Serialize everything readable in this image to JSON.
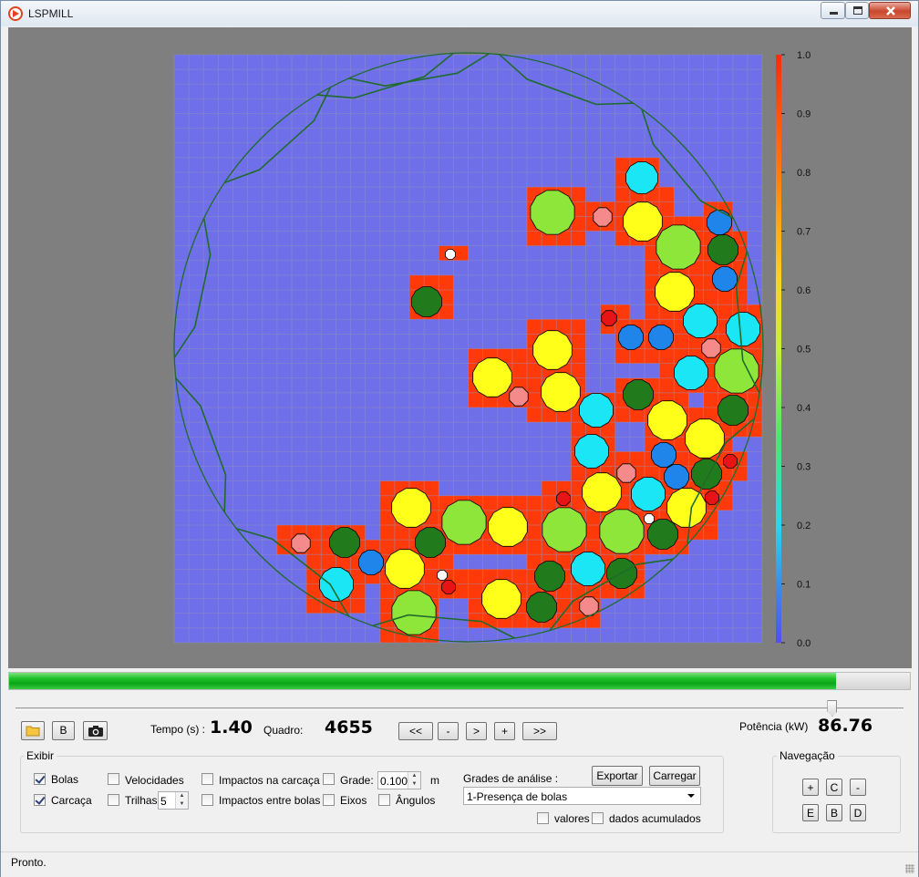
{
  "window": {
    "title": "LSPMILL"
  },
  "viewport": {
    "colorbar_ticks": [
      "1.0",
      "0.9",
      "0.8",
      "0.7",
      "0.6",
      "0.5",
      "0.4",
      "0.3",
      "0.2",
      "0.1",
      "0.0"
    ],
    "colors": {
      "background": "#7f7f7f",
      "empty_cell": "#6f6fe9",
      "occupied_cell": "#ff3a0a",
      "shell_line": "#1f6b2c"
    },
    "ball_colors": {
      "lime": "#8fe63a",
      "yellow": "#ffff1a",
      "cyan": "#1ae6f5",
      "blue": "#1f85ea",
      "darkgreen": "#217a1c",
      "pink": "#f58a8a",
      "red": "#e61414",
      "white": "#ffffff"
    }
  },
  "simulation": {
    "progress_fraction": 0.918,
    "slider_fraction": 0.925
  },
  "toolbar": {
    "b_label": "B",
    "time_label": "Tempo (s) :",
    "time_value": "1.40",
    "frame_label": "Quadro:",
    "frame_value": "4655",
    "nav_first": "<<",
    "nav_prev": "-",
    "nav_next": ">",
    "nav_plus": "+",
    "nav_last": ">>",
    "power_label": "Potência (kW)",
    "power_value": "86.76"
  },
  "exibir": {
    "title": "Exibir",
    "bolas": {
      "label": "Bolas",
      "checked": true
    },
    "carcaca": {
      "label": "Carcaça",
      "checked": true
    },
    "velocidades": {
      "label": "Velocidades",
      "checked": false
    },
    "trilhas": {
      "label": "Trilhas",
      "checked": false,
      "value": "5"
    },
    "impactos_carcaca": {
      "label": "Impactos na carcaça",
      "checked": false
    },
    "impactos_bolas": {
      "label": "Impactos entre bolas",
      "checked": false
    },
    "grade": {
      "label": "Grade:",
      "checked": false,
      "value": "0.100",
      "unit": "m"
    },
    "eixos": {
      "label": "Eixos",
      "checked": false
    },
    "angulos": {
      "label": "Ângulos",
      "checked": false
    },
    "grades_label": "Grades de análise :",
    "exportar": "Exportar",
    "carregar": "Carregar",
    "grades_selected": "1-Presença de bolas",
    "valores": {
      "label": "valores",
      "checked": false
    },
    "dados_acumulados": {
      "label": "dados acumulados",
      "checked": false
    }
  },
  "navegacao": {
    "title": "Navegação",
    "plus": "+",
    "c": "C",
    "minus": "-",
    "e": "E",
    "b": "B",
    "d": "D"
  },
  "status": {
    "text": "Pronto."
  }
}
